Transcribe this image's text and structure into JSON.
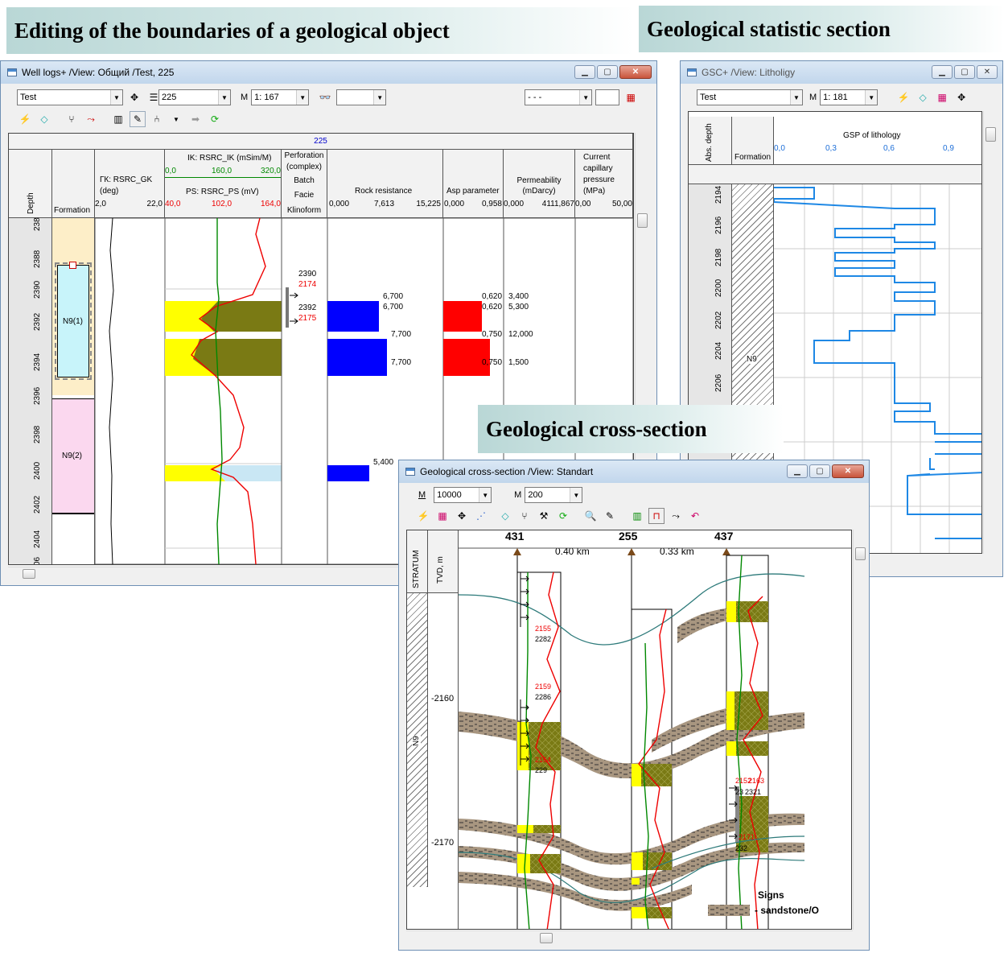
{
  "banners": {
    "editing": "Editing of the boundaries of a geological object",
    "statistic": "Geological statistic section",
    "cross": "Geological cross-section"
  },
  "well_logs": {
    "title": "Well logs+ /View: Общий /Test, 225",
    "combo_view": "Test",
    "combo_well": "225",
    "scale_label": "M",
    "combo_scale": "1: 167",
    "combo_line": "- - -",
    "well_header": "225",
    "columns": {
      "depth": "Depth",
      "formation": "Formation",
      "gk_title": "ГК: RSRC_GK",
      "gk_unit": "(deg)",
      "gk_min": "2,0",
      "gk_max": "22,0",
      "ik_title": "IK: RSRC_IK (mSim/M)",
      "ik_t0": "0,0",
      "ik_t1": "160,0",
      "ik_t2": "320,0",
      "ps_title": "PS: RSRC_PS (mV)",
      "ps_t0": "40,0",
      "ps_t1": "102,0",
      "ps_t2": "164,0",
      "perf1": "Perforation",
      "perf2": "(complex)",
      "batch": "Batch",
      "facie": "Facie",
      "klinoform": "Klinoform",
      "rock": "Rock resistance",
      "rock_t0": "0,000",
      "rock_t1": "7,613",
      "rock_t2": "15,225",
      "asp": "Asp parameter",
      "asp_t0": "0,000",
      "asp_t1": "0,958",
      "perm1": "Permeability",
      "perm2": "(mDarcy)",
      "perm_t0": "0,000",
      "perm_t1": "4111,867",
      "cap1": "Current",
      "cap2": "capillary",
      "cap3": "pressure",
      "cap4": "(MPa)",
      "cap_t0": "0,00",
      "cap_t1": "50,00"
    },
    "depths": [
      "238",
      "2388",
      "2390",
      "2392",
      "2394",
      "2396",
      "2398",
      "2400",
      "2402",
      "2404",
      "06"
    ],
    "formations": [
      "N9(1)",
      "N9(2)"
    ],
    "perf_labels": [
      {
        "a": "2390",
        "b": "2174"
      },
      {
        "a": "2392",
        "b": "2175"
      }
    ],
    "rock_values": [
      "6,700",
      "6,700",
      "7,700",
      "7,700",
      "5,400"
    ],
    "asp_values": [
      "0,620",
      "0,620",
      "0,750",
      "0,750"
    ],
    "perm_values": [
      "3,400",
      "5,300",
      "12,000",
      "1,500"
    ]
  },
  "gsc": {
    "title": "GSC+ /View: Litholigy",
    "combo_view": "Test",
    "scale_label": "M",
    "combo_scale": "1: 181",
    "abs_depth": "Abs. depth",
    "formation": "Formation",
    "gsp_title": "GSP of lithology",
    "ticks": [
      "0,0",
      "0,3",
      "0,6",
      "0,9"
    ],
    "depths": [
      "2194",
      "2196",
      "2198",
      "2200",
      "2202",
      "2204",
      "2206",
      "08"
    ],
    "formation_name": "N9"
  },
  "cross": {
    "title": "Geological cross-section /View: Standart",
    "scale_label_h": "M",
    "combo_h": "10000",
    "scale_label_v": "M",
    "combo_v": "200",
    "stratum": "STRATUM",
    "tvd": "TVD, m",
    "wells": [
      "431",
      "255",
      "437"
    ],
    "distances": [
      "0.40 km",
      "0.33 km"
    ],
    "tvd_labels": [
      "-2160",
      "-2170"
    ],
    "stratum_name": "N9",
    "well431_labels": [
      {
        "a": "2155",
        "b": "2282"
      },
      {
        "a": "2159",
        "b": "2286"
      },
      {
        "a": "2164",
        "b": "229"
      }
    ],
    "well437_labels": [
      {
        "a": "2152",
        "b": "23"
      },
      {
        "a": "2163",
        "b": "2321"
      },
      {
        "a": "2171",
        "b": "232"
      }
    ],
    "legend_title": "Signs",
    "legend_item": "- sandstone/O"
  },
  "colors": {
    "yellow": "#ffff00",
    "olive": "#7a7a14",
    "blue": "#0000ff",
    "red": "#ff0000",
    "green": "#008000",
    "sand": "#a89680",
    "gsp": "#1e88e5"
  }
}
